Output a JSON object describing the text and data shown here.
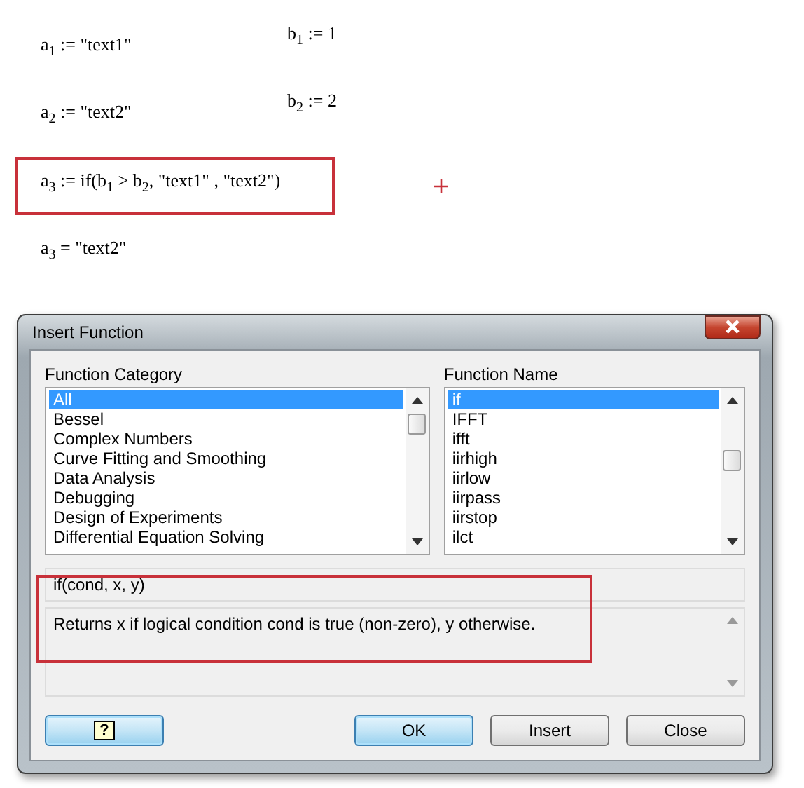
{
  "worksheet": {
    "regions": [
      {
        "text": "a$_{1}$ := \"text1\""
      },
      {
        "text": "b$_{1}$ := 1"
      },
      {
        "text": "a$_{2}$ := \"text2\""
      },
      {
        "text": "b$_{2}$ := 2"
      },
      {
        "text": "a$_{3}$ := if(b$_{1}$ > b$_{2}$, \"text1\" , \"text2\")",
        "highlighted": true
      },
      {
        "text": "a$_{3}$ = \"text2\""
      }
    ]
  },
  "dialog": {
    "title": "Insert Function",
    "category": {
      "label": "Function Category",
      "items": [
        {
          "label": "All",
          "selected": true
        },
        {
          "label": "Bessel",
          "selected": false
        },
        {
          "label": "Complex Numbers",
          "selected": false
        },
        {
          "label": "Curve Fitting and Smoothing",
          "selected": false
        },
        {
          "label": "Data Analysis",
          "selected": false
        },
        {
          "label": "Debugging",
          "selected": false
        },
        {
          "label": "Design of Experiments",
          "selected": false
        },
        {
          "label": "Differential Equation Solving",
          "selected": false
        }
      ]
    },
    "function": {
      "label": "Function Name",
      "items": [
        {
          "label": "if",
          "selected": true
        },
        {
          "label": "IFFT",
          "selected": false
        },
        {
          "label": "ifft",
          "selected": false
        },
        {
          "label": "iirhigh",
          "selected": false
        },
        {
          "label": "iirlow",
          "selected": false
        },
        {
          "label": "iirpass",
          "selected": false
        },
        {
          "label": "iirstop",
          "selected": false
        },
        {
          "label": "ilct",
          "selected": false
        }
      ]
    },
    "signature": "if(cond, x, y)",
    "description": "Returns x if logical condition cond is true (non-zero), y otherwise.",
    "help_button": "?",
    "buttons": [
      {
        "label": "OK",
        "default": true
      },
      {
        "label": "Insert",
        "default": false
      },
      {
        "label": "Close",
        "default": false
      }
    ]
  }
}
